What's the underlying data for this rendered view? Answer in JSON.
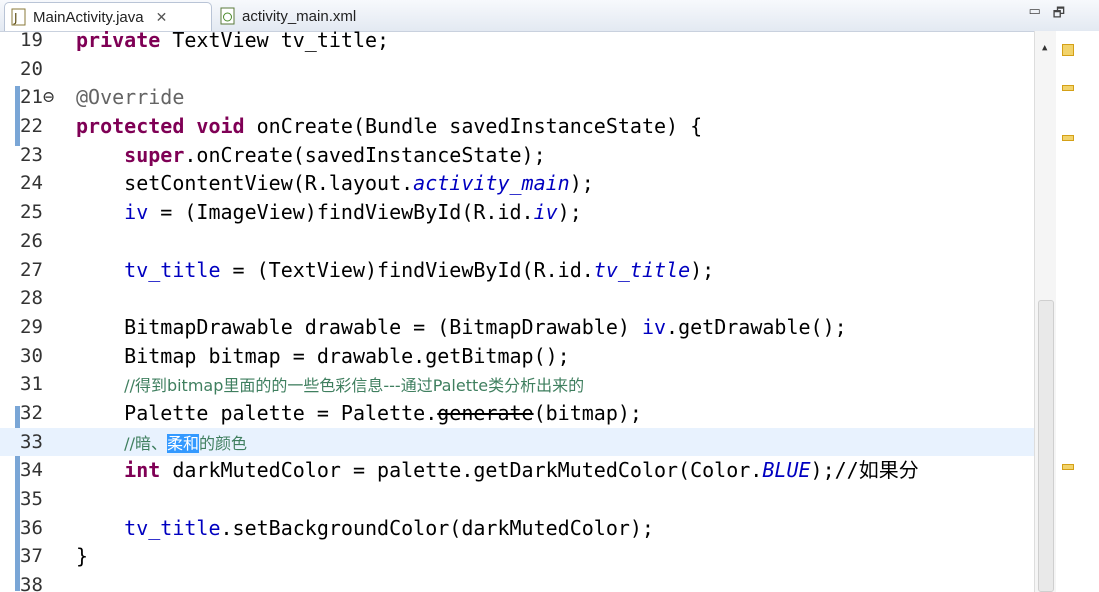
{
  "tabs": [
    {
      "label": "MainActivity.java",
      "active": true,
      "icon": "java-file-icon"
    },
    {
      "label": "activity_main.xml",
      "active": false,
      "icon": "xml-file-icon"
    }
  ],
  "window_controls": {
    "minimize": "▭",
    "maximize": "🗗"
  },
  "editor": {
    "lines": [
      {
        "n": "19"
      },
      {
        "n": "20"
      },
      {
        "n": "21⊖"
      },
      {
        "n": "22"
      },
      {
        "n": "23"
      },
      {
        "n": "24"
      },
      {
        "n": "25"
      },
      {
        "n": "26"
      },
      {
        "n": "27"
      },
      {
        "n": "28"
      },
      {
        "n": "29"
      },
      {
        "n": "30"
      },
      {
        "n": "31"
      },
      {
        "n": "32"
      },
      {
        "n": "33"
      },
      {
        "n": "34"
      },
      {
        "n": "35"
      },
      {
        "n": "36"
      },
      {
        "n": "37"
      },
      {
        "n": "38"
      }
    ],
    "code": {
      "l19_kw": "private",
      "l19_rest": " TextView tv_title;",
      "l21": "@Override",
      "l22_kw1": "protected",
      "l22_kw2": "void",
      "l22_rest": " onCreate(Bundle savedInstanceState) {",
      "l23_kw": "super",
      "l23_rest": ".onCreate(savedInstanceState);",
      "l24_a": "setContentView(R.layout.",
      "l24_b": "activity_main",
      "l24_c": ");",
      "l25_a": "iv",
      "l25_b": " = (ImageView)findViewById(R.id.",
      "l25_c": "iv",
      "l25_d": ");",
      "l27_a": "tv_title",
      "l27_b": " = (TextView)findViewById(R.id.",
      "l27_c": "tv_title",
      "l27_d": ");",
      "l29_a": "BitmapDrawable drawable = (BitmapDrawable) ",
      "l29_b": "iv",
      "l29_c": ".getDrawable();",
      "l30": "Bitmap bitmap = drawable.getBitmap();",
      "l31": "//得到bitmap里面的的一些色彩信息---通过Palette类分析出来的",
      "l32_a": "Palette palette = Palette.",
      "l32_b": "generate",
      "l32_c": "(bitmap);",
      "l33_a": "//暗、",
      "l33_b": "柔和",
      "l33_c": "的颜色",
      "l34_kw": "int",
      "l34_a": " darkMutedColor = palette.getDarkMutedColor(Color.",
      "l34_b": "BLUE",
      "l34_c": ");//如果分",
      "l36_a": "tv_title",
      "l36_b": ".setBackgroundColor(darkMutedColor);",
      "l37": "}"
    }
  },
  "colors": {
    "keyword": "#7f0055",
    "field": "#0000c0",
    "comment": "#3f7f5f",
    "annotation": "#646464",
    "current_line": "#e8f2fe",
    "selection": "#3399ff"
  }
}
